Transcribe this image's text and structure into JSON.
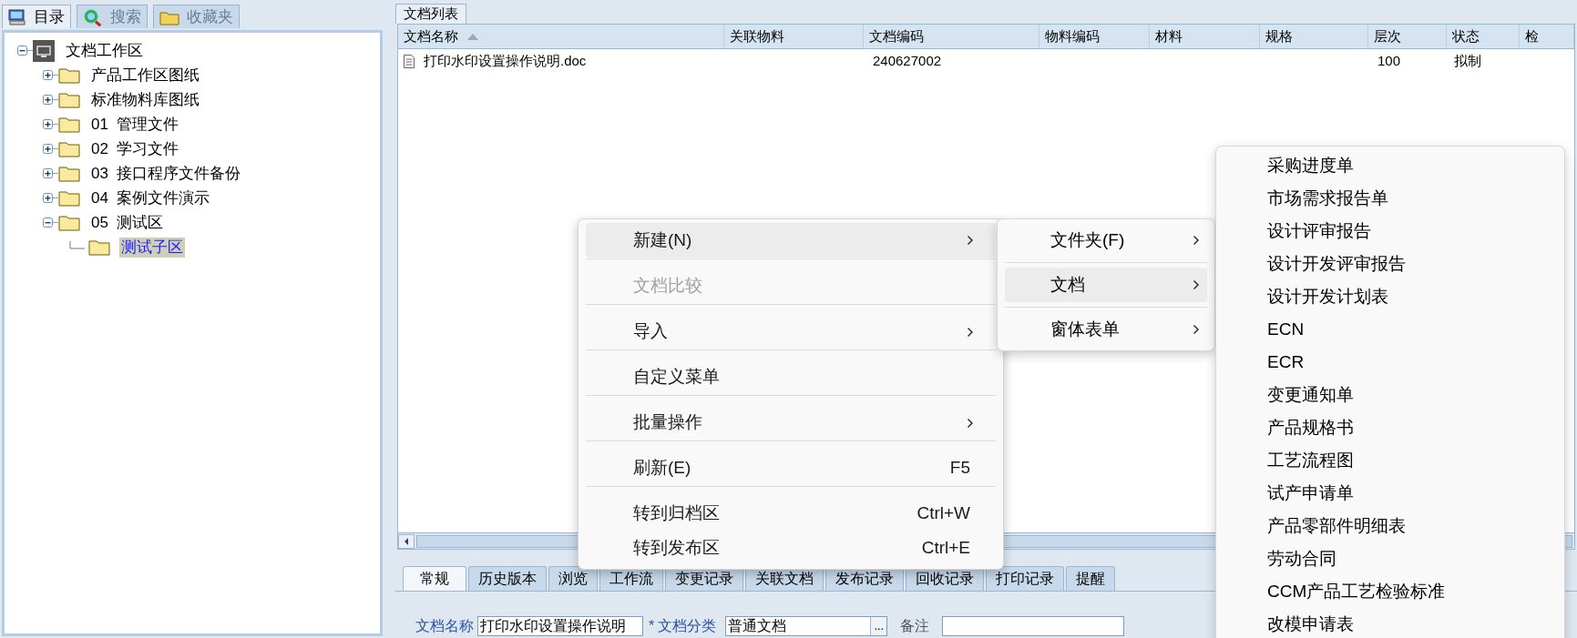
{
  "left_tabs": [
    {
      "label": "目录",
      "selected": true
    },
    {
      "label": "搜索",
      "selected": false
    },
    {
      "label": "收藏夹",
      "selected": false
    }
  ],
  "tree": [
    {
      "label": "文档工作区",
      "kind": "root",
      "expanded": true,
      "selected": false,
      "children": [
        {
          "label": "产品工作区图纸",
          "kind": "folder",
          "expanded": false,
          "selected": false
        },
        {
          "label": "标准物料库图纸",
          "kind": "folder",
          "expanded": false,
          "selected": false
        },
        {
          "label": "01  管理文件",
          "kind": "folder",
          "expanded": false,
          "selected": false
        },
        {
          "label": "02  学习文件",
          "kind": "folder",
          "expanded": false,
          "selected": false
        },
        {
          "label": "03  接口程序文件备份",
          "kind": "folder",
          "expanded": false,
          "selected": false
        },
        {
          "label": "04  案例文件演示",
          "kind": "folder",
          "expanded": false,
          "selected": false
        },
        {
          "label": "05  测试区",
          "kind": "folder",
          "expanded": true,
          "selected": false,
          "children": [
            {
              "label": "测试子区",
              "kind": "folder",
              "selected": true
            }
          ]
        }
      ]
    }
  ],
  "list_tab": {
    "label": "文档列表",
    "selected": true
  },
  "table": {
    "columns": [
      {
        "label": "文档名称",
        "sorted": true
      },
      {
        "label": "关联物料"
      },
      {
        "label": "文档编码"
      },
      {
        "label": "物料编码"
      },
      {
        "label": "材料"
      },
      {
        "label": "规格"
      },
      {
        "label": "层次"
      },
      {
        "label": "状态"
      },
      {
        "label": "检"
      }
    ],
    "rows": [
      {
        "name": "打印水印设置操作说明.doc",
        "code": "240627002",
        "tier": "100",
        "status": "拟制",
        "selected": false
      }
    ]
  },
  "detail_tabs": [
    {
      "label": "常规",
      "selected": true
    },
    {
      "label": "历史版本",
      "selected": false
    },
    {
      "label": "浏览",
      "selected": false
    },
    {
      "label": "工作流",
      "selected": false
    },
    {
      "label": "变更记录",
      "selected": false
    },
    {
      "label": "关联文档",
      "selected": false
    },
    {
      "label": "发布记录",
      "selected": false
    },
    {
      "label": "回收记录",
      "selected": false
    },
    {
      "label": "打印记录",
      "selected": false
    },
    {
      "label": "提醒",
      "selected": false
    }
  ],
  "form": {
    "name_label": "文档名称",
    "name_value": "打印水印设置操作说明",
    "required_mark": "*",
    "category_label": "文档分类",
    "category_value": "普通文档",
    "browse_button": "...",
    "note_label": "备注"
  },
  "context_menu": [
    {
      "label": "新建(N)",
      "submenu": true,
      "disabled": false,
      "highlighted": true,
      "divider_above": false
    },
    {
      "label": "文档比较",
      "submenu": false,
      "disabled": true,
      "highlighted": false,
      "divider_above": true
    },
    {
      "label": "导入",
      "submenu": true,
      "disabled": false,
      "highlighted": false,
      "divider_above": true
    },
    {
      "label": "自定义菜单",
      "submenu": false,
      "disabled": false,
      "highlighted": false,
      "divider_above": true
    },
    {
      "label": "批量操作",
      "submenu": true,
      "disabled": false,
      "highlighted": false,
      "divider_above": true
    },
    {
      "label": "刷新(E)",
      "shortcut": "F5",
      "submenu": false,
      "disabled": false,
      "highlighted": false,
      "divider_above": true
    },
    {
      "label": "转到归档区",
      "shortcut": "Ctrl+W",
      "submenu": false,
      "disabled": false,
      "highlighted": false,
      "divider_above": true
    },
    {
      "label": "转到发布区",
      "shortcut": "Ctrl+E",
      "submenu": false,
      "disabled": false,
      "highlighted": false,
      "divider_above": false
    }
  ],
  "new_submenu": [
    {
      "label": "文件夹(F)",
      "submenu": true,
      "highlighted": false,
      "divider_above": false
    },
    {
      "label": "文档",
      "submenu": true,
      "highlighted": true,
      "divider_above": true
    },
    {
      "label": "窗体表单",
      "submenu": true,
      "highlighted": false,
      "divider_above": true
    }
  ],
  "document_submenu": [
    "采购进度单",
    "市场需求报告单",
    "设计评审报告",
    "设计开发评审报告",
    "设计开发计划表",
    "ECN",
    "ECR",
    "变更通知单",
    "产品规格书",
    "工艺流程图",
    "试产申请单",
    "产品零部件明细表",
    "劳动合同",
    "CCM产品工艺检验标准",
    "改模申请表"
  ]
}
